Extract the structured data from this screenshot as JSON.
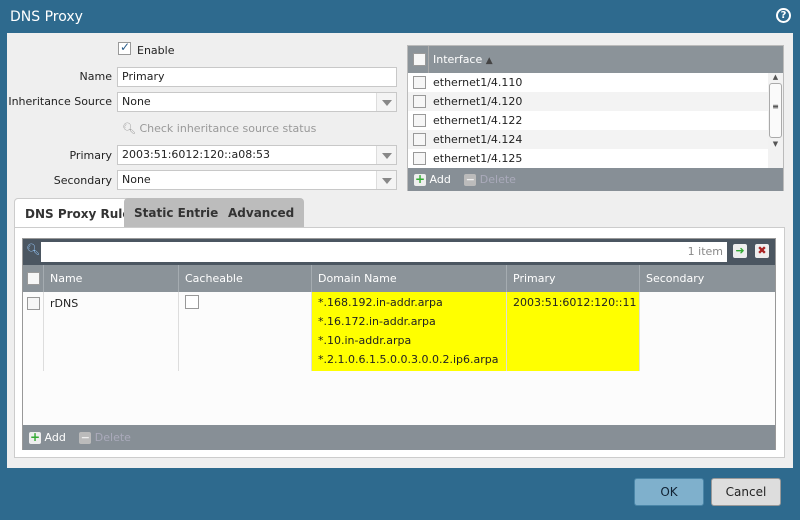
{
  "dialog": {
    "title": "DNS Proxy",
    "help_icon": "question-circle-icon"
  },
  "form": {
    "enable_label": "Enable",
    "enable_checked": true,
    "name_label": "Name",
    "name_value": "Primary",
    "inheritance_label": "Inheritance Source",
    "inheritance_value": "None",
    "check_link": "Check inheritance source status",
    "primary_label": "Primary",
    "primary_value": "2003:51:6012:120::a08:53",
    "secondary_label": "Secondary",
    "secondary_value": "None"
  },
  "interfaces": {
    "header": "Interface",
    "items": [
      "ethernet1/4.110",
      "ethernet1/4.120",
      "ethernet1/4.122",
      "ethernet1/4.124",
      "ethernet1/4.125"
    ],
    "add": "Add",
    "delete": "Delete"
  },
  "tabs": [
    {
      "label": "DNS Proxy Rules",
      "active": true
    },
    {
      "label": "Static Entries"
    },
    {
      "label": "Advanced"
    }
  ],
  "rules": {
    "count": "1 item",
    "columns": [
      "Name",
      "Cacheable",
      "Domain Name",
      "Primary",
      "Secondary"
    ],
    "rows": [
      {
        "name": "rDNS",
        "cacheable": false,
        "domains": [
          "*.168.192.in-addr.arpa",
          "*.16.172.in-addr.arpa",
          "*.10.in-addr.arpa",
          "*.2.1.0.6.1.5.0.0.3.0.0.2.ip6.arpa"
        ],
        "primary": "2003:51:6012:120::11",
        "secondary": ""
      }
    ],
    "add": "Add",
    "delete": "Delete",
    "highlight_color": "#ffff00"
  },
  "buttons": {
    "ok": "OK",
    "cancel": "Cancel"
  }
}
